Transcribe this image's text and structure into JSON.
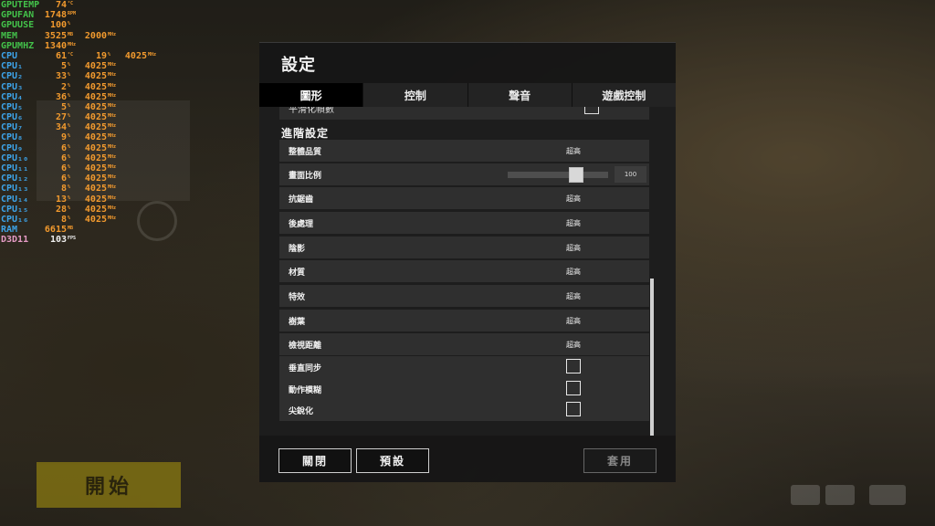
{
  "osd": [
    {
      "label": "GPUTEMP",
      "label_color": "green",
      "v1": "74",
      "u1": "°C"
    },
    {
      "label": "GPUFAN",
      "label_color": "green",
      "v1": "1748",
      "u1": "RPM"
    },
    {
      "label": "GPUUSE",
      "label_color": "green",
      "v1": "100",
      "u1": "%"
    },
    {
      "label": "MEM",
      "label_color": "green",
      "v1": "3525",
      "u1": "MB",
      "v2": "2000",
      "u2": "MHz"
    },
    {
      "label": "GPUMHZ",
      "label_color": "green",
      "v1": "1340",
      "u1": "MHz"
    },
    {
      "label": "CPU",
      "label_color": "blue",
      "v1": "61",
      "u1": "°C",
      "v2": "19",
      "u2": "%",
      "v3": "4025",
      "u3": "MHz"
    },
    {
      "label": "CPU₁",
      "label_color": "blue",
      "v1": "5",
      "u1": "%",
      "v2": "4025",
      "u2": "MHz"
    },
    {
      "label": "CPU₂",
      "label_color": "blue",
      "v1": "33",
      "u1": "%",
      "v2": "4025",
      "u2": "MHz"
    },
    {
      "label": "CPU₃",
      "label_color": "blue",
      "v1": "2",
      "u1": "%",
      "v2": "4025",
      "u2": "MHz"
    },
    {
      "label": "CPU₄",
      "label_color": "blue",
      "v1": "36",
      "u1": "%",
      "v2": "4025",
      "u2": "MHz"
    },
    {
      "label": "CPU₅",
      "label_color": "blue",
      "v1": "5",
      "u1": "%",
      "v2": "4025",
      "u2": "MHz"
    },
    {
      "label": "CPU₆",
      "label_color": "blue",
      "v1": "27",
      "u1": "%",
      "v2": "4025",
      "u2": "MHz"
    },
    {
      "label": "CPU₇",
      "label_color": "blue",
      "v1": "34",
      "u1": "%",
      "v2": "4025",
      "u2": "MHz"
    },
    {
      "label": "CPU₈",
      "label_color": "blue",
      "v1": "9",
      "u1": "%",
      "v2": "4025",
      "u2": "MHz"
    },
    {
      "label": "CPU₉",
      "label_color": "blue",
      "v1": "6",
      "u1": "%",
      "v2": "4025",
      "u2": "MHz"
    },
    {
      "label": "CPU₁₀",
      "label_color": "blue",
      "v1": "6",
      "u1": "%",
      "v2": "4025",
      "u2": "MHz"
    },
    {
      "label": "CPU₁₁",
      "label_color": "blue",
      "v1": "6",
      "u1": "%",
      "v2": "4025",
      "u2": "MHz"
    },
    {
      "label": "CPU₁₂",
      "label_color": "blue",
      "v1": "6",
      "u1": "%",
      "v2": "4025",
      "u2": "MHz"
    },
    {
      "label": "CPU₁₃",
      "label_color": "blue",
      "v1": "8",
      "u1": "%",
      "v2": "4025",
      "u2": "MHz"
    },
    {
      "label": "CPU₁₄",
      "label_color": "blue",
      "v1": "13",
      "u1": "%",
      "v2": "4025",
      "u2": "MHz"
    },
    {
      "label": "CPU₁₅",
      "label_color": "blue",
      "v1": "28",
      "u1": "%",
      "v2": "4025",
      "u2": "MHz"
    },
    {
      "label": "CPU₁₆",
      "label_color": "blue",
      "v1": "8",
      "u1": "%",
      "v2": "4025",
      "u2": "MHz"
    },
    {
      "label": "RAM",
      "label_color": "blue",
      "v1": "6615",
      "u1": "MB"
    },
    {
      "label": "D3D11",
      "label_color": "pink",
      "v1": "103",
      "u1": "FPS",
      "v1_color": "white"
    }
  ],
  "colors": {
    "green": "#43c24a",
    "blue": "#3da3e8",
    "orange": "#f29a2e",
    "pink": "#e59bc5",
    "white": "#f1f1f1"
  },
  "background": {
    "start_label": "開始"
  },
  "dialog": {
    "title": "設定",
    "tabs": [
      {
        "label": "圖形",
        "active": true
      },
      {
        "label": "控制",
        "active": false
      },
      {
        "label": "聲音",
        "active": false
      },
      {
        "label": "遊戲控制",
        "active": false
      }
    ],
    "partial_row_label": "平滑化幀數",
    "section_title": "進階設定",
    "rows": [
      {
        "label": "整體品質",
        "value": "超高"
      },
      {
        "label": "畫面比例",
        "slider_value": "100",
        "slider_fraction": 0.7
      },
      {
        "label": "抗鋸齒",
        "value": "超高"
      },
      {
        "label": "後處理",
        "value": "超高"
      },
      {
        "label": "陰影",
        "value": "超高"
      },
      {
        "label": "材質",
        "value": "超高"
      },
      {
        "label": "特效",
        "value": "超高"
      },
      {
        "label": "樹葉",
        "value": "超高"
      },
      {
        "label": "檢視距離",
        "value": "超高"
      },
      {
        "label": "垂直同步",
        "checked": false
      },
      {
        "label": "動作模糊",
        "checked": false
      },
      {
        "label": "尖銳化",
        "checked": false
      }
    ],
    "buttons": {
      "close": "關閉",
      "default": "預設",
      "apply": "套用"
    }
  }
}
